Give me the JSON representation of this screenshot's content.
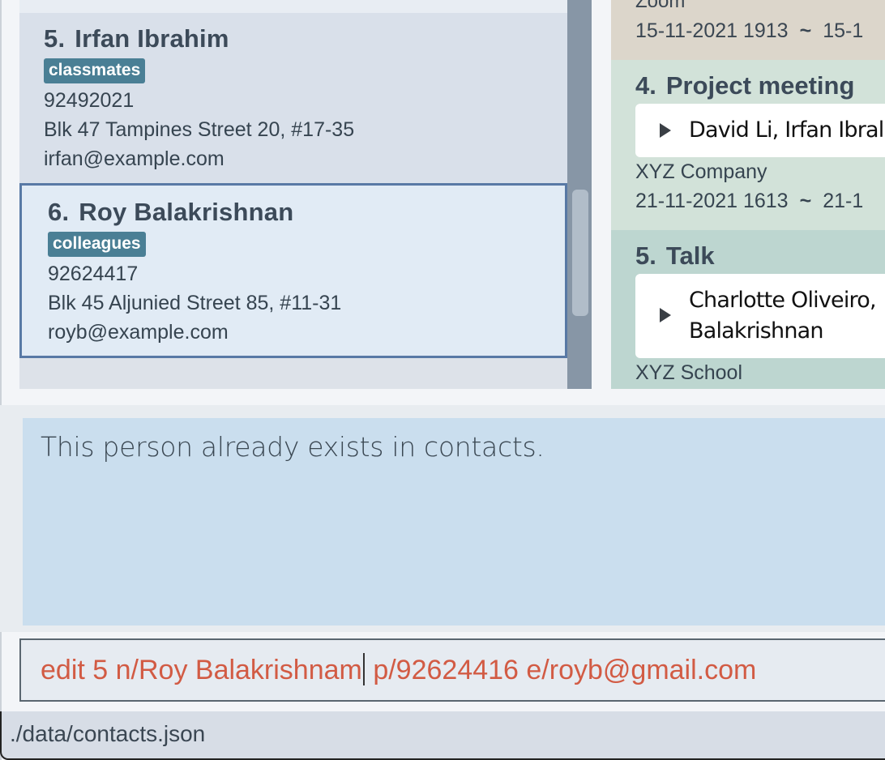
{
  "contacts": [
    {
      "index": "5.",
      "name": "Irfan Ibrahim",
      "tag": "classmates",
      "phone": "92492021",
      "address": "Blk 47 Tampines Street 20, #17-35",
      "email": "irfan@example.com"
    },
    {
      "index": "6.",
      "name": "Roy Balakrishnan",
      "tag": "colleagues",
      "phone": "92624417",
      "address": "Blk 45 Aljunied Street 85, #11-31",
      "email": "royb@example.com"
    }
  ],
  "events": [
    {
      "place": "Zoom",
      "start": "15-11-2021 1913",
      "separator": "~",
      "end": "15-1"
    },
    {
      "index": "4.",
      "title": "Project meeting",
      "attendees": "David Li, Irfan Ibral",
      "place": "XYZ Company",
      "start": "21-11-2021 1613",
      "separator": "~",
      "end": "21-1"
    },
    {
      "index": "5.",
      "title": "Talk",
      "attendees_line1": "Charlotte Oliveiro,",
      "attendees_line2": "Balakrishnan",
      "place": "XYZ School"
    }
  ],
  "result": {
    "message": "This person already exists in contacts."
  },
  "command": {
    "before_caret": "edit 5 n/Roy Balakrishnam",
    "after_caret": " p/92624416 e/royb@gmail.com"
  },
  "status": {
    "file_path": "./data/contacts.json"
  },
  "colors": {
    "tag_bg": "#4a7f95",
    "command_text": "#d25b44",
    "selected_border": "#5879a5",
    "result_bg": "#cadeee"
  }
}
